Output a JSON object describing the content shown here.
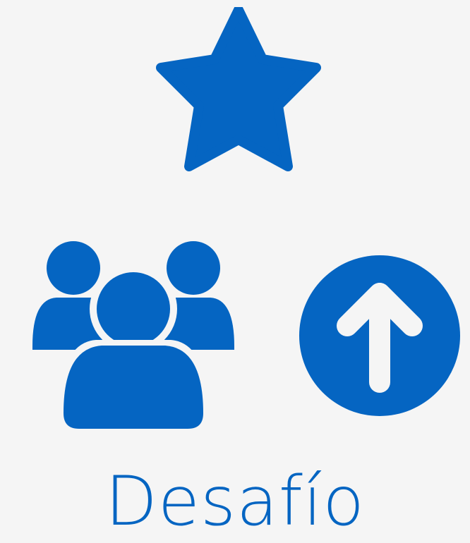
{
  "title": "Desafío",
  "icons": {
    "star": "star-icon",
    "group": "users-group-icon",
    "arrow": "arrow-up-circle-icon"
  },
  "colors": {
    "background": "#f5f5f5",
    "accent": "#0565c2"
  }
}
